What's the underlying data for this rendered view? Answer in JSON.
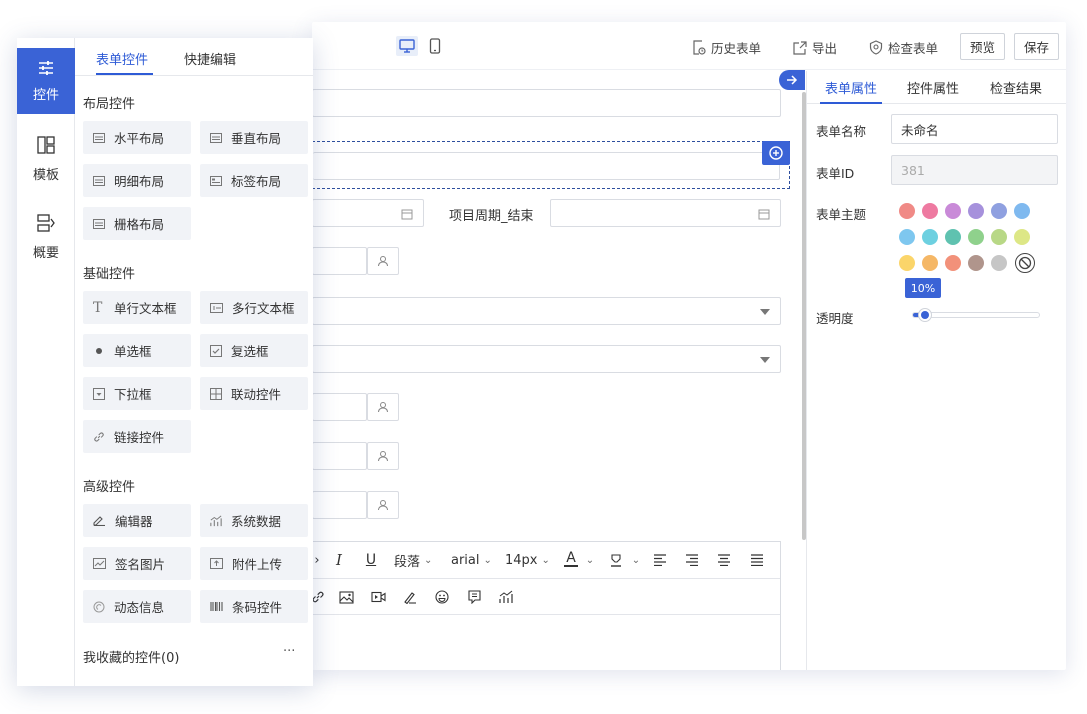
{
  "toolbar": {
    "history": "历史表单",
    "export": "导出",
    "check": "检查表单",
    "preview": "预览",
    "save": "保存"
  },
  "canvas": {
    "period_end_label": "项目周期_结束"
  },
  "editor": {
    "paragraph": "段落",
    "font": "arial",
    "size": "14px"
  },
  "right_panel": {
    "tabs": [
      "表单属性",
      "控件属性",
      "检查结果"
    ],
    "form_name_label": "表单名称",
    "form_name_value": "未命名",
    "form_id_label": "表单ID",
    "form_id_value": "381",
    "theme_label": "表单主题",
    "theme_colors": [
      "#f08a86",
      "#ee7aa1",
      "#c98ad8",
      "#a691dc",
      "#8fa0e0",
      "#7fb9ef",
      "#7ec7ef",
      "#6dd0e0",
      "#5fc2b0",
      "#8fd18c",
      "#b8d886",
      "#dde786",
      "#fbd56a",
      "#f5b766",
      "#f2917a",
      "#b0958c",
      "#c6c6c6"
    ],
    "opacity_label": "透明度",
    "opacity_value": "10%",
    "opacity_fraction": 0.1
  },
  "left_panel": {
    "side": {
      "controls": "控件",
      "templates": "模板",
      "overview": "概要"
    },
    "tabs": {
      "controls": "表单控件",
      "quick_edit": "快捷编辑"
    },
    "sections": {
      "layout": "布局控件",
      "basic": "基础控件",
      "advanced": "高级控件",
      "favorites": "我收藏的控件(0)",
      "more": "···"
    },
    "layout_controls": [
      "水平布局",
      "垂直布局",
      "明细布局",
      "标签布局",
      "栅格布局"
    ],
    "basic_controls": [
      "单行文本框",
      "多行文本框",
      "单选框",
      "复选框",
      "下拉框",
      "联动控件",
      "链接控件"
    ],
    "advanced_controls": [
      "编辑器",
      "系统数据",
      "签名图片",
      "附件上传",
      "动态信息",
      "条码控件"
    ]
  }
}
